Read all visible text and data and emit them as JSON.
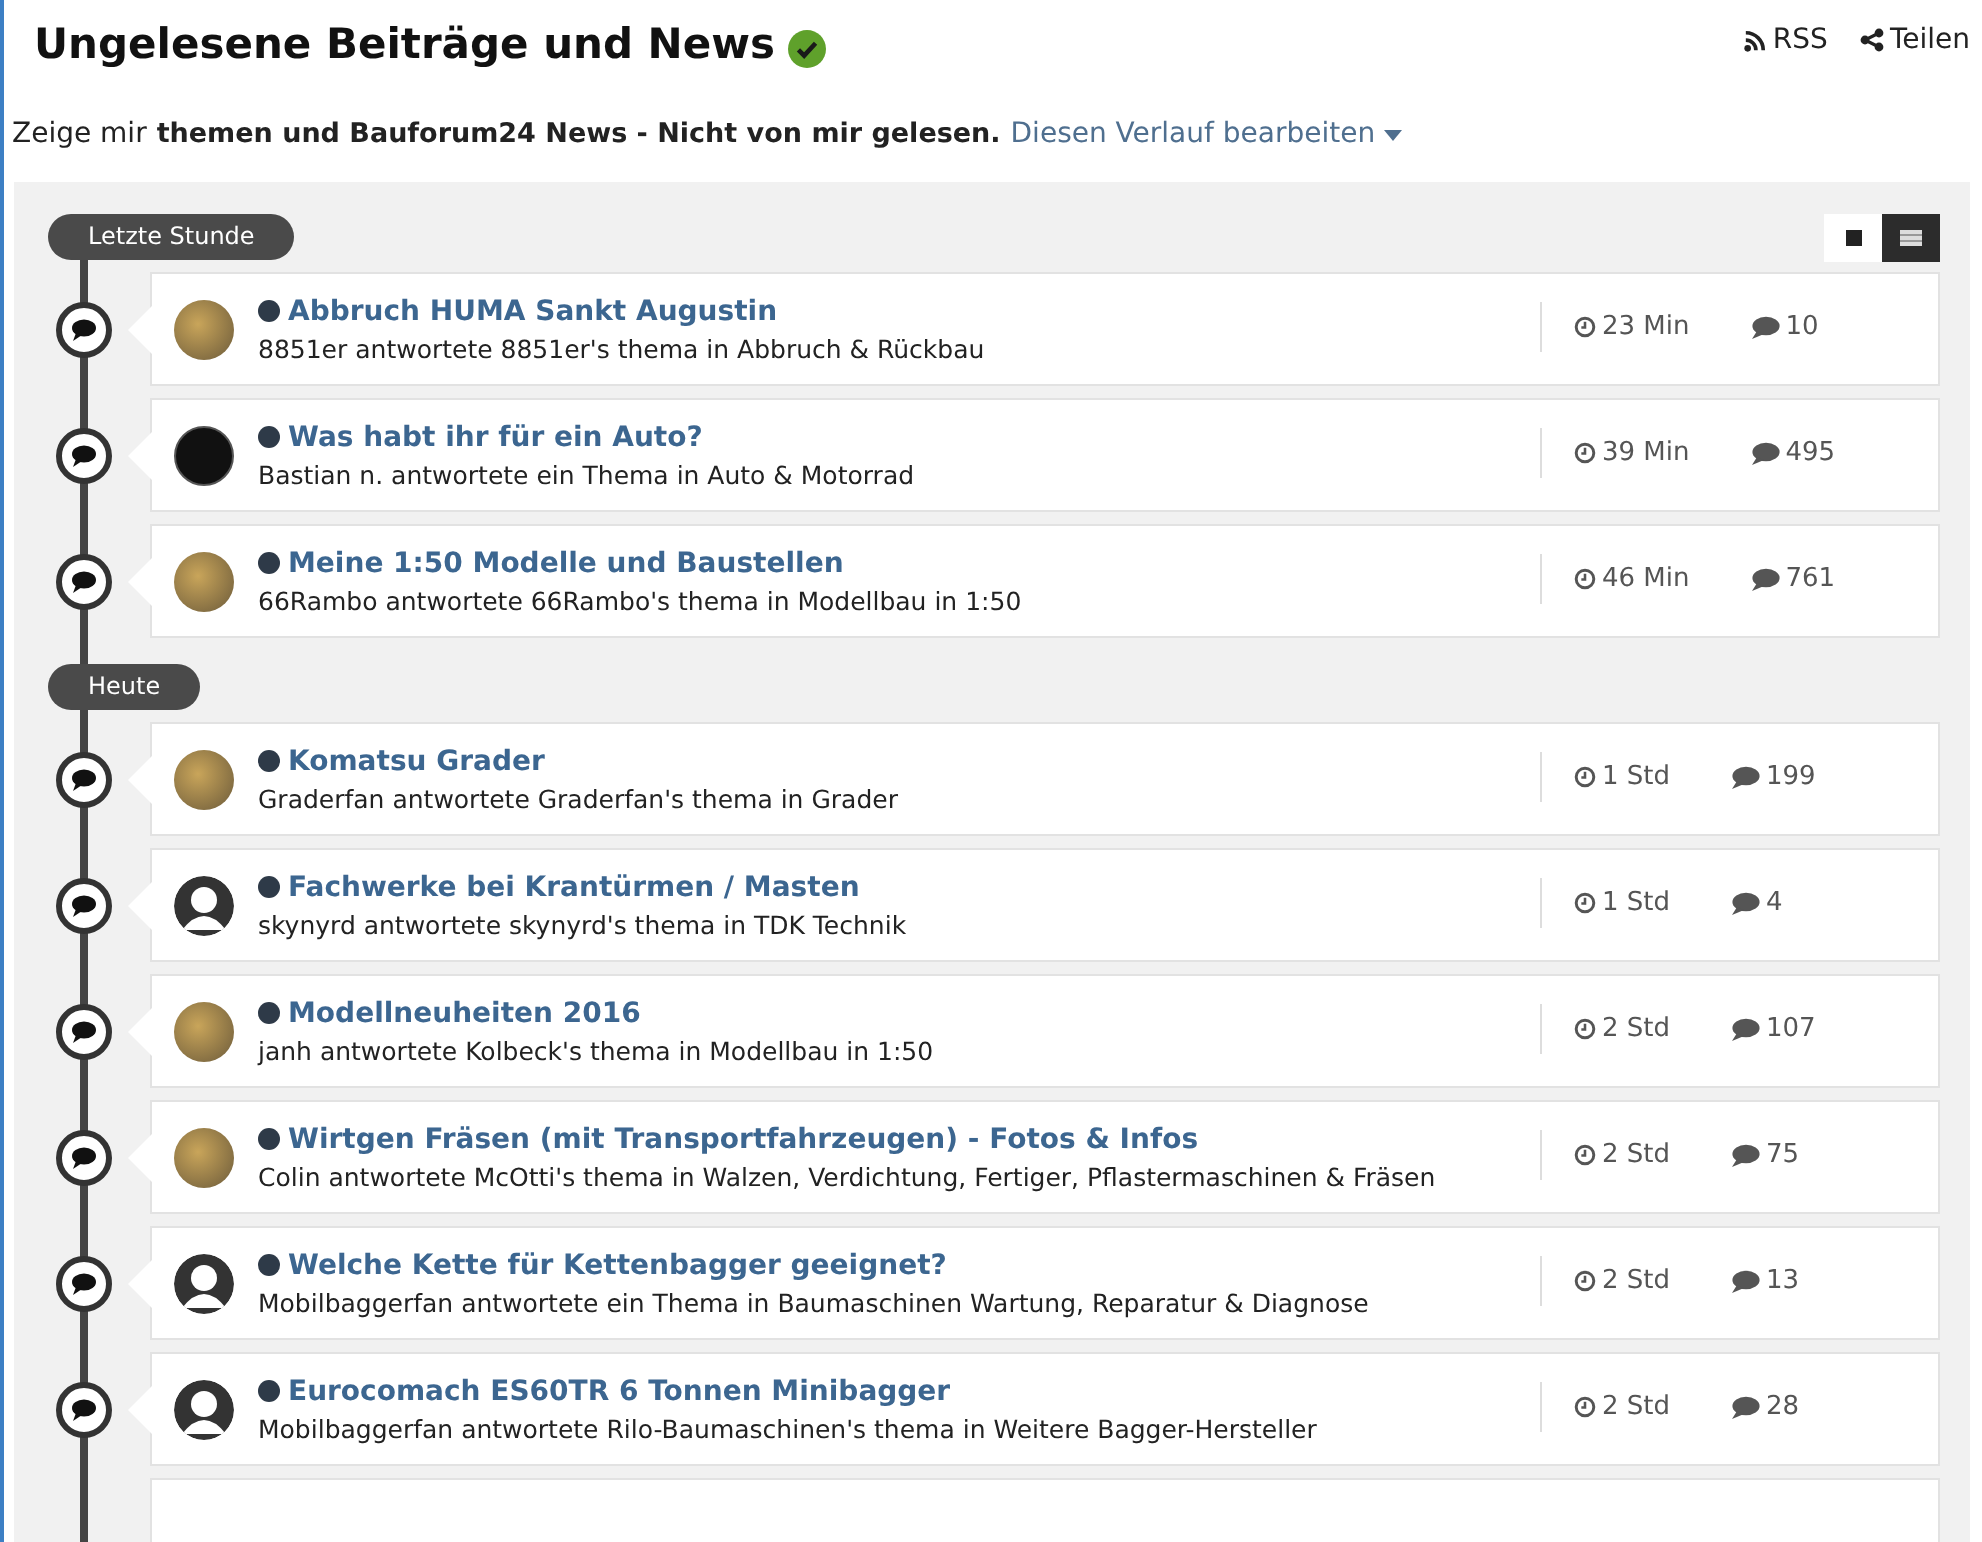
{
  "header": {
    "title": "Ungelesene Beiträge und News",
    "verified": true,
    "actions": [
      {
        "kind": "rss",
        "label": "RSS"
      },
      {
        "kind": "share",
        "label": "Teilen"
      }
    ]
  },
  "filter": {
    "prefix": "Zeige mir",
    "value": "themen und Bauforum24 News - Nicht von mir gelesen.",
    "edit_link": "Diesen Verlauf bearbeiten"
  },
  "view_modes": [
    {
      "kind": "condensed",
      "selected": false
    },
    {
      "kind": "expanded",
      "selected": true
    }
  ],
  "groups": [
    {
      "label": "Letzte Stunde",
      "items": [
        {
          "title": "Abbruch HUMA Sankt Augustin",
          "subtitle": "8851er antwortete 8851er's thema in Abbruch & Rückbau",
          "time": "23 Min",
          "replies": "10",
          "avatar": {
            "kind": "photo"
          }
        },
        {
          "title": "Was habt ihr für ein Auto?",
          "subtitle": "Bastian n. antwortete ein Thema in Auto & Motorrad",
          "time": "39 Min",
          "replies": "495",
          "avatar": {
            "kind": "dark-photo"
          }
        },
        {
          "title": "Meine 1:50 Modelle und Baustellen",
          "subtitle": "66Rambo antwortete 66Rambo's thema in Modellbau in 1:50",
          "time": "46 Min",
          "replies": "761",
          "avatar": {
            "kind": "photo"
          }
        }
      ]
    },
    {
      "label": "Heute",
      "items": [
        {
          "title": "Komatsu Grader",
          "subtitle": "Graderfan antwortete Graderfan's thema in Grader",
          "time": "1 Std",
          "replies": "199",
          "avatar": {
            "kind": "photo"
          }
        },
        {
          "title": "Fachwerke bei Krantürmen / Masten",
          "subtitle": "skynyrd antwortete skynyrd's thema in TDK Technik",
          "time": "1 Std",
          "replies": "4",
          "avatar": {
            "kind": "silhouette"
          }
        },
        {
          "title": "Modellneuheiten 2016",
          "subtitle": "janh antwortete Kolbeck's thema in Modellbau in 1:50",
          "time": "2 Std",
          "replies": "107",
          "avatar": {
            "kind": "photo"
          }
        },
        {
          "title": "Wirtgen Fräsen (mit Transportfahrzeugen) - Fotos & Infos",
          "subtitle": "Colin antwortete McOtti's thema in Walzen, Verdichtung, Fertiger, Pflastermaschinen & Fräsen",
          "time": "2 Std",
          "replies": "75",
          "avatar": {
            "kind": "photo"
          }
        },
        {
          "title": "Welche Kette für Kettenbagger geeignet?",
          "subtitle": "Mobilbaggerfan antwortete ein Thema in Baumaschinen Wartung, Reparatur & Diagnose",
          "time": "2 Std",
          "replies": "13",
          "avatar": {
            "kind": "silhouette"
          }
        },
        {
          "title": "Eurocomach ES60TR 6 Tonnen Minibagger",
          "subtitle": "Mobilbaggerfan antwortete Rilo-Baumaschinen's thema in Weitere Bagger-Hersteller",
          "time": "2 Std",
          "replies": "28",
          "avatar": {
            "kind": "silhouette"
          }
        }
      ]
    }
  ]
}
